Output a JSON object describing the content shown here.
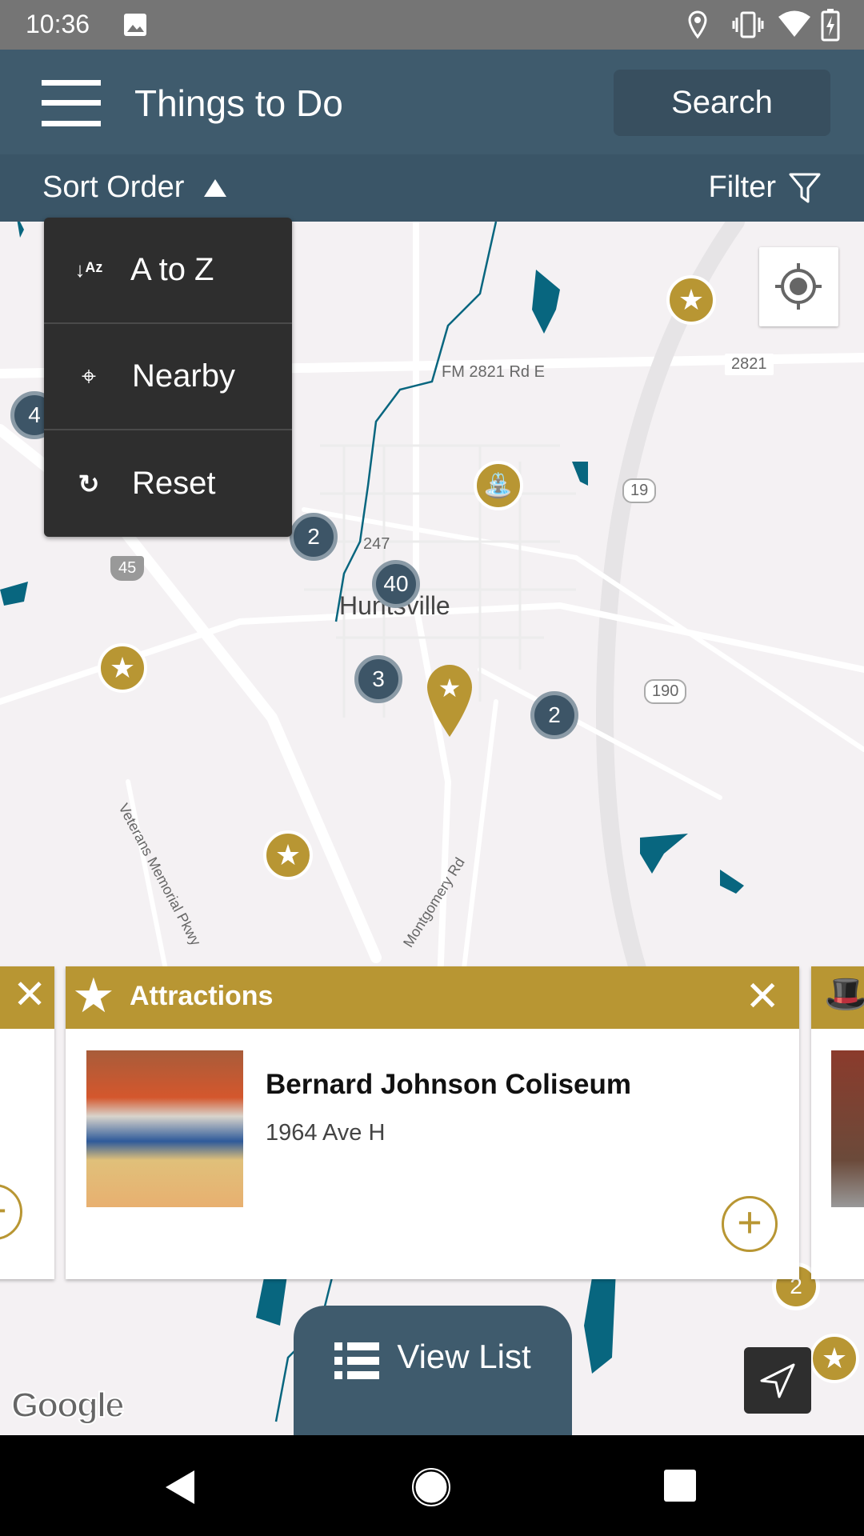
{
  "status_bar": {
    "time": "10:36",
    "icons": [
      "image-icon",
      "location-icon",
      "vibrate-icon",
      "wifi-icon",
      "battery-charging-icon"
    ]
  },
  "app_bar": {
    "title": "Things to Do",
    "search_label": "Search",
    "menu_icon": "hamburger-icon"
  },
  "sort_bar": {
    "sort_label": "Sort Order",
    "filter_label": "Filter"
  },
  "sort_menu": {
    "items": [
      {
        "label": "A to Z",
        "icon": "sort-alpha-icon"
      },
      {
        "label": "Nearby",
        "icon": "crosshair-icon"
      },
      {
        "label": "Reset",
        "icon": "reset-icon"
      }
    ]
  },
  "map": {
    "labels": {
      "road1": "FM 2821 Rd E",
      "road2": "Veterans Memorial Pkwy",
      "road3": "Montgomery Rd",
      "city": "Huntsville"
    },
    "shields": {
      "s1": "2821",
      "s2": "19",
      "s3": "247",
      "s4": "45",
      "s5": "190"
    },
    "clusters": {
      "c1": "4",
      "c2": "2",
      "c3": "40",
      "c4": "3",
      "c5": "2",
      "c6": "2"
    },
    "google_logo": "Google"
  },
  "card": {
    "category": "Attractions",
    "title": "Bernard Johnson Coliseum",
    "address": "1964 Ave H"
  },
  "view_list_label": "View List",
  "colors": {
    "primary": "#3f5b6d",
    "accent": "#b89633",
    "water": "#08667f"
  }
}
